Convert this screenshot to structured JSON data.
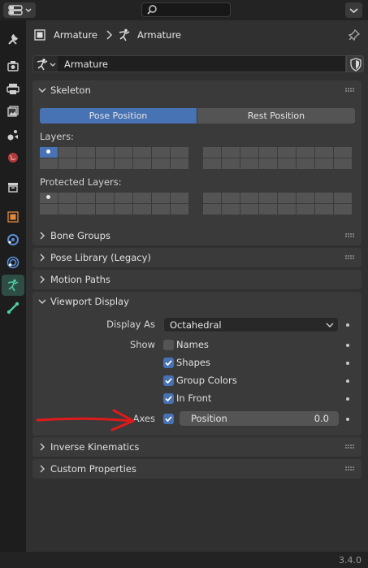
{
  "header": {
    "object_name": "Armature",
    "data_name": "Armature"
  },
  "context": {
    "datablock_name": "Armature"
  },
  "skeleton": {
    "title": "Skeleton",
    "pose_position": "Pose Position",
    "rest_position": "Rest Position",
    "layers_label": "Layers:",
    "protected_layers_label": "Protected Layers:"
  },
  "panels": {
    "bone_groups": "Bone Groups",
    "pose_library": "Pose Library (Legacy)",
    "motion_paths": "Motion Paths",
    "viewport_display": "Viewport Display",
    "inverse_kinematics": "Inverse Kinematics",
    "custom_properties": "Custom Properties"
  },
  "viewport_display": {
    "display_as_label": "Display As",
    "display_as_value": "Octahedral",
    "show_label": "Show",
    "names_label": "Names",
    "names_checked": false,
    "shapes_label": "Shapes",
    "shapes_checked": true,
    "group_colors_label": "Group Colors",
    "group_colors_checked": true,
    "in_front_label": "In Front",
    "in_front_checked": true,
    "axes_label": "Axes",
    "axes_checked": true,
    "position_label": "Position",
    "position_value": "0.0"
  },
  "status": {
    "version": "3.4.0"
  },
  "colors": {
    "accent_blue": "#4772b3",
    "armature_green": "#4ecb9f",
    "annotation_red": "#e01a1a"
  },
  "icons": [
    "editor-type-icon",
    "search-icon",
    "chevron-down-icon",
    "tool-icon",
    "render-icon",
    "output-icon",
    "view-layer-icon",
    "scene-icon",
    "world-icon",
    "collection-icon",
    "object-icon",
    "modifier-icon",
    "physics-icon",
    "armature-icon",
    "bone-icon",
    "pin-icon",
    "fake-user-shield-icon",
    "drag-grip-icon"
  ]
}
